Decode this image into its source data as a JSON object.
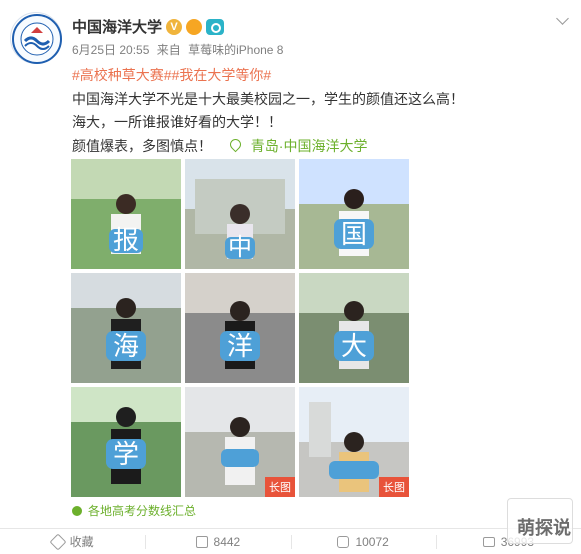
{
  "header": {
    "name": "中国海洋大学",
    "vip_badge": "V",
    "meta": {
      "date": "6月25日 20:55",
      "source_prefix": "来自",
      "source": "草莓味的iPhone 8"
    }
  },
  "post": {
    "hashtags": "#高校种草大赛##我在大学等你#",
    "line1": "中国海洋大学不光是十大最美校园之一，学生的颜值还这么高！",
    "line2": "海大，一所谁报谁好看的大学！！",
    "line3_start": "颜值爆表，多图慎点！",
    "location": "青岛·中国海洋大学"
  },
  "images": [
    {
      "char": "报",
      "bg": "#7fae6c",
      "accent": "#4ea0d7"
    },
    {
      "char": "中",
      "bg": "#b0b7a6",
      "accent": "#4ea0d7"
    },
    {
      "char": "国",
      "bg": "#a7b894",
      "accent": "#4ea0d7"
    },
    {
      "char": "海",
      "bg": "#93a18f",
      "accent": "#4ea0d7"
    },
    {
      "char": "洋",
      "bg": "#8b8b8b",
      "accent": "#4ea0d7"
    },
    {
      "char": "大",
      "bg": "#7b8e71",
      "accent": "#4ea0d7"
    },
    {
      "char": "学",
      "bg": "#6a9960",
      "accent": "#4ea0d7"
    },
    {
      "char": "",
      "bg": "#b6b8b0",
      "accent": "#4ea0d7",
      "badge": "长图"
    },
    {
      "char": "",
      "bg": "#c6c6c3",
      "accent": "#4ea0d7",
      "badge": "长图"
    }
  ],
  "footer_link": "各地高考分数线汇总",
  "actions": {
    "collect": "收藏",
    "share": "8442",
    "comment": "10072",
    "like": "36993"
  },
  "watermark": "萌探说",
  "colors": {
    "hashtag": "#eb7350",
    "link_green": "#6cb02c"
  }
}
